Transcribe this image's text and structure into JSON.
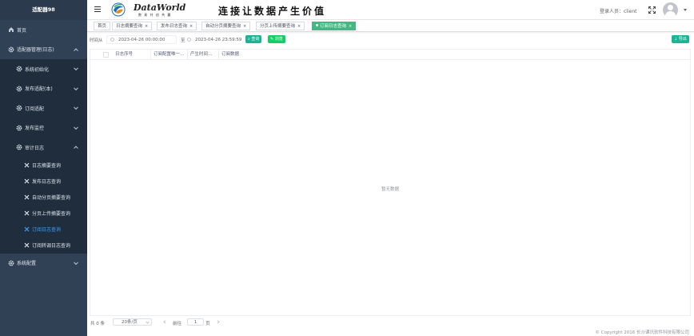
{
  "sidebar": {
    "title": "适配器98",
    "home": "首页",
    "group": "适配器管理(日志)",
    "items": [
      "系统初始化",
      "发布适配(本)",
      "订阅适配",
      "发布监控"
    ],
    "audit": "审计日志",
    "audit_leaves": [
      "日志摘要查询",
      "发布日志查询",
      "自动分页摘要查询",
      "分页上传摘要查询",
      "订阅日志查询",
      "订阅转调日志查询"
    ],
    "config": "系统配置"
  },
  "header": {
    "brand": "DataWorld",
    "brand_sub": "数 易 共 创 共 赢",
    "slogan": "连接让数据产生价值",
    "user_label": "登录人员：client"
  },
  "tabs": [
    {
      "label": "首页"
    },
    {
      "label": "日志摘要查询"
    },
    {
      "label": "发布日志查询"
    },
    {
      "label": "自动分页摘要查询"
    },
    {
      "label": "分页上传摘要查询"
    },
    {
      "label": "订阅日志查询"
    }
  ],
  "filters": {
    "time_label": "时间从",
    "start": "2023-04-26 00:00:00",
    "to_label": "至",
    "end": "2023-04-26 23:59:59",
    "search": "查询",
    "reset": "浏览",
    "export": "导出"
  },
  "table": {
    "columns": [
      "日志序号",
      "订阅配置唯一...",
      "产生时间...",
      "订阅数据"
    ],
    "empty_text": "暂无数据"
  },
  "pager": {
    "total": "共 0 条",
    "page_size": "20条/页",
    "goto": "前往",
    "page": "1",
    "page_suffix": "页"
  },
  "footer": "© Copyright 2016 长沙课讯软件科技有限公司",
  "colors": {
    "sidebar_bg": "#304156",
    "active_tab": "#42b983",
    "primary_btn": "#1ab394",
    "active_link": "#409eff"
  }
}
